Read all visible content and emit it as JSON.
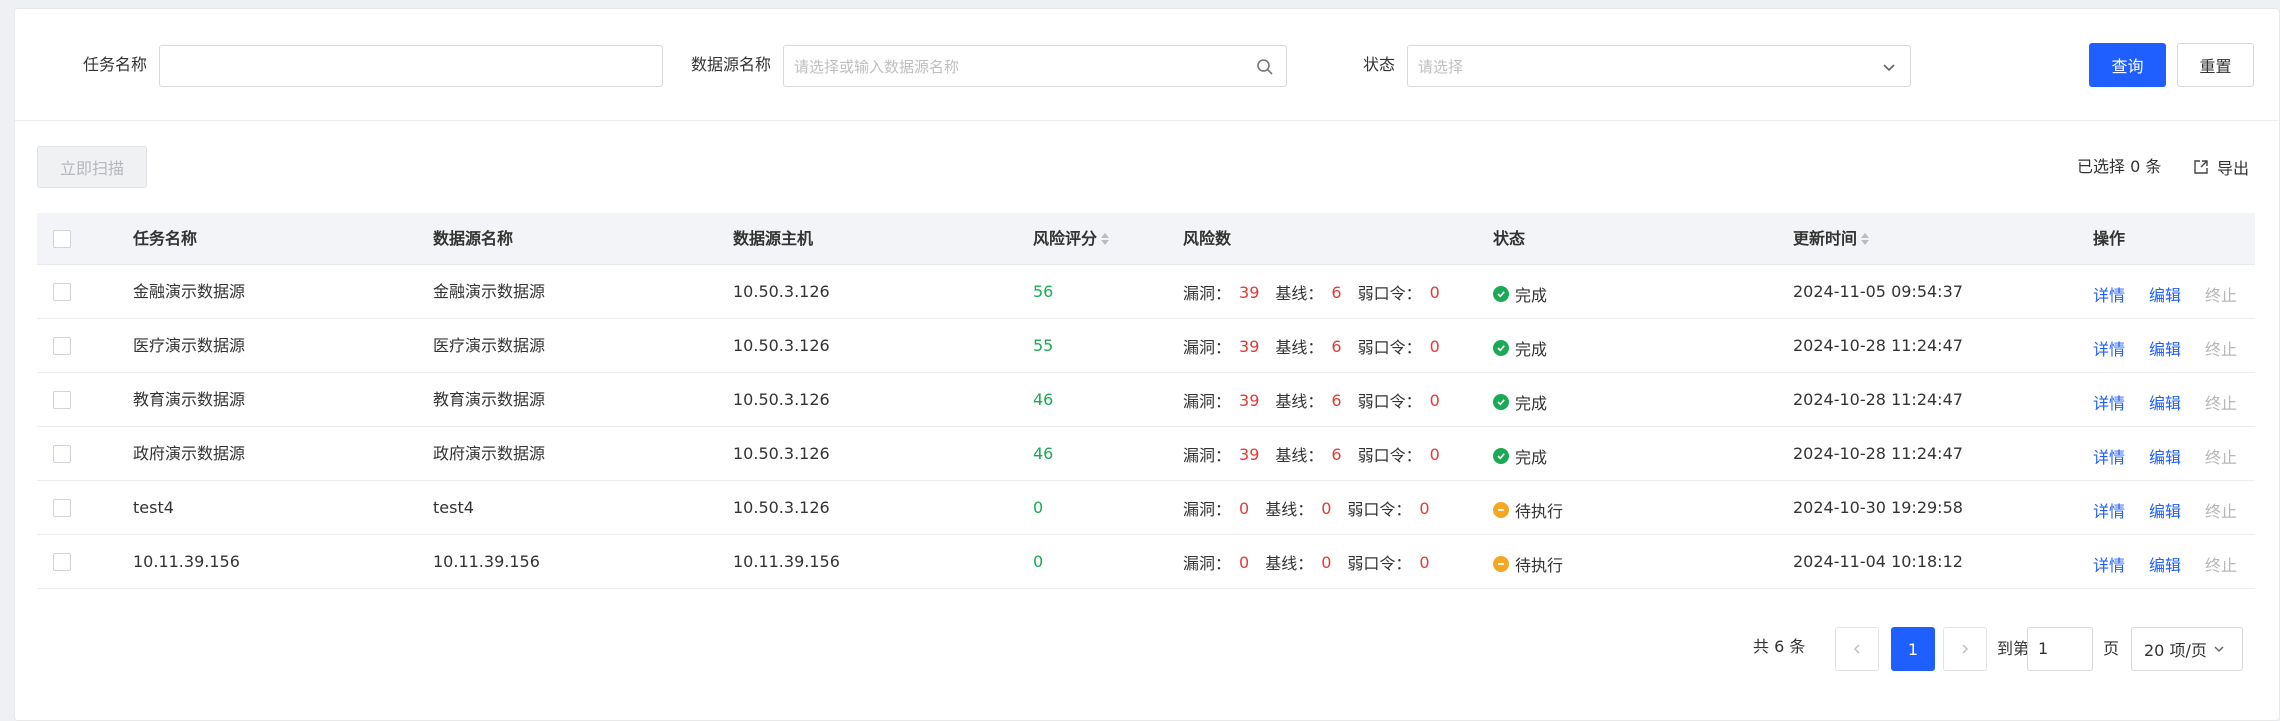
{
  "filters": {
    "task_name_label": "任务名称",
    "task_name_value": "",
    "datasource_label": "数据源名称",
    "datasource_placeholder": "请选择或输入数据源名称",
    "status_label": "状态",
    "status_placeholder": "请选择",
    "query_button": "查询",
    "reset_button": "重置"
  },
  "toolbar": {
    "scan_button": "立即扫描",
    "selected_text": "已选择 0 条",
    "export_label": "导出"
  },
  "table": {
    "headers": {
      "task_name": "任务名称",
      "datasource_name": "数据源名称",
      "host": "数据源主机",
      "risk_score": "风险评分",
      "risk_count": "风险数",
      "status": "状态",
      "updated": "更新时间",
      "actions": "操作"
    },
    "risk_labels": {
      "vuln": "漏洞：",
      "baseline": "基线：",
      "weak": "弱口令："
    },
    "action_labels": {
      "detail": "详情",
      "edit": "编辑",
      "stop": "终止"
    },
    "rows": [
      {
        "task": "金融演示数据源",
        "ds": "金融演示数据源",
        "host": "10.50.3.126",
        "score": "56",
        "vuln": "39",
        "baseline": "6",
        "weak": "0",
        "status": "完成",
        "status_type": "done",
        "updated": "2024-11-05 09:54:37"
      },
      {
        "task": "医疗演示数据源",
        "ds": "医疗演示数据源",
        "host": "10.50.3.126",
        "score": "55",
        "vuln": "39",
        "baseline": "6",
        "weak": "0",
        "status": "完成",
        "status_type": "done",
        "updated": "2024-10-28 11:24:47"
      },
      {
        "task": "教育演示数据源",
        "ds": "教育演示数据源",
        "host": "10.50.3.126",
        "score": "46",
        "vuln": "39",
        "baseline": "6",
        "weak": "0",
        "status": "完成",
        "status_type": "done",
        "updated": "2024-10-28 11:24:47"
      },
      {
        "task": "政府演示数据源",
        "ds": "政府演示数据源",
        "host": "10.50.3.126",
        "score": "46",
        "vuln": "39",
        "baseline": "6",
        "weak": "0",
        "status": "完成",
        "status_type": "done",
        "updated": "2024-10-28 11:24:47"
      },
      {
        "task": "test4",
        "ds": "test4",
        "host": "10.50.3.126",
        "score": "0",
        "vuln": "0",
        "baseline": "0",
        "weak": "0",
        "status": "待执行",
        "status_type": "wait",
        "updated": "2024-10-30 19:29:58"
      },
      {
        "task": "10.11.39.156",
        "ds": "10.11.39.156",
        "host": "10.11.39.156",
        "score": "0",
        "vuln": "0",
        "baseline": "0",
        "weak": "0",
        "status": "待执行",
        "status_type": "wait",
        "updated": "2024-11-04 10:18:12"
      }
    ]
  },
  "pagination": {
    "total": "共 6 条",
    "current_page": "1",
    "goto_prefix": "到第",
    "goto_value": "1",
    "goto_suffix": "页",
    "page_size": "20 项/页"
  },
  "colors": {
    "primary": "#1f5fff",
    "score_green": "#1aaa55",
    "risk_red": "#e53935",
    "status_done": "#1aaa55",
    "status_wait": "#f5a623"
  }
}
